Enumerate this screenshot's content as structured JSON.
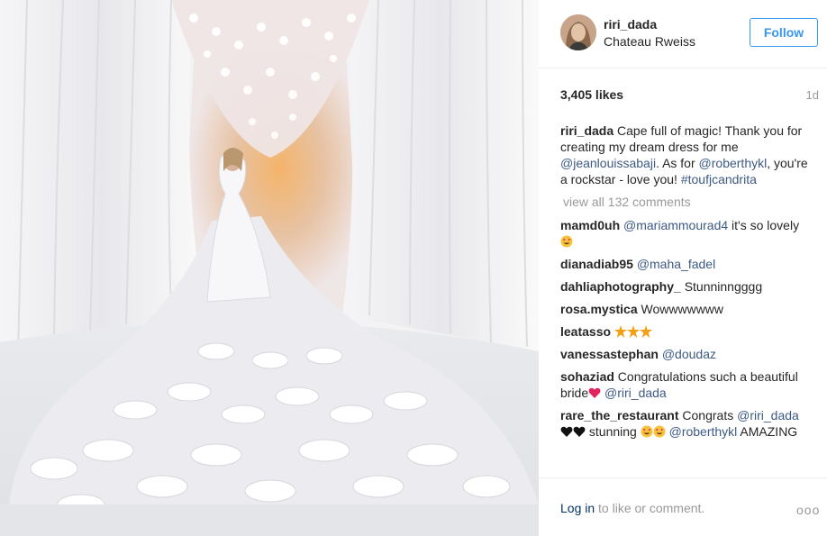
{
  "post": {
    "username": "riri_dada",
    "location": "Chateau Rweiss",
    "follow_label": "Follow",
    "likes": "3,405 likes",
    "age": "1d"
  },
  "caption": {
    "user": "riri_dada",
    "text1": "Cape full of magic! Thank you for creating my dream dress for me",
    "mention1": "@jeanlouissabaji",
    "text2": ". As for",
    "mention2": "@roberthykl",
    "text3": ", you're a rockstar - love you!",
    "hashtag": "#toufjcandrita"
  },
  "view_all": "view all 132 comments",
  "comments": [
    {
      "user": "mamd0uh",
      "mention": "@mariammourad4",
      "text": "it's so lovely",
      "emoji": [
        "heart-eyes-icon"
      ]
    },
    {
      "user": "dianadiab95",
      "mention": "@maha_fadel",
      "text": ""
    },
    {
      "user": "dahliaphotography_",
      "text": "Stunninngggg"
    },
    {
      "user": "rosa.mystica",
      "text": "Wowwwwwww"
    },
    {
      "user": "leatasso",
      "emoji": [
        "dizzy-star-icon",
        "dizzy-star-icon",
        "dizzy-star-icon"
      ]
    },
    {
      "user": "vanessastephan",
      "mention": "@doudaz"
    },
    {
      "user": "sohaziad",
      "text": "Congratulations such a beautiful bride",
      "emoji": [
        "red-heart-icon"
      ],
      "mention": "@riri_dada"
    },
    {
      "user": "rare_the_restaurant",
      "text": "Congrats",
      "mention": "@riri_dada",
      "emoji": [
        "black-heart-icon",
        "black-heart-icon"
      ],
      "text2": "stunning",
      "emoji2": [
        "heart-eyes-icon",
        "heart-eyes-icon"
      ],
      "mention2": "@roberthykl",
      "text3": "AMAZING"
    }
  ],
  "footer": {
    "login_link": "Log in",
    "login_text": "to like or comment.",
    "more": "ooo"
  },
  "colors": {
    "accent": "#3897f0",
    "link": "#003569",
    "mention": "#3d5a84",
    "muted": "#999999"
  }
}
